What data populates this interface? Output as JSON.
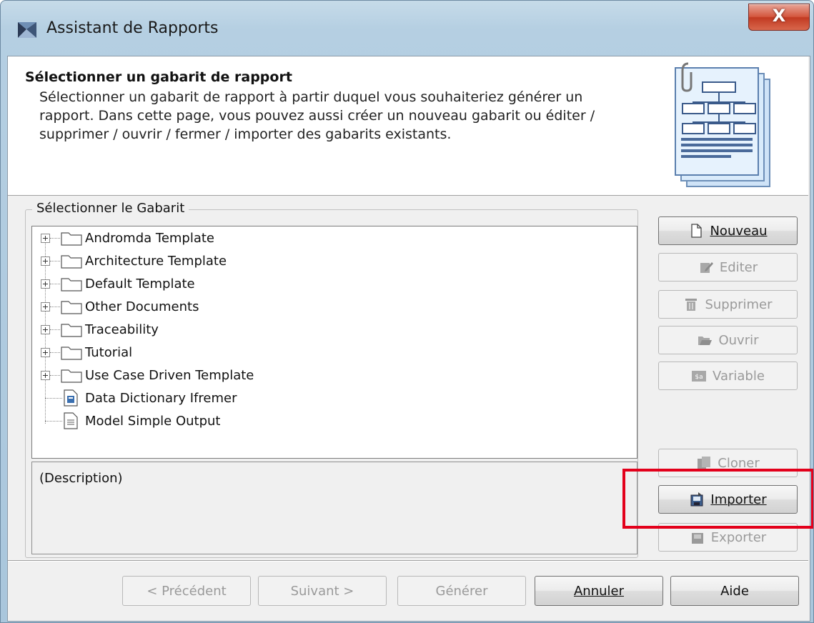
{
  "window": {
    "title": "Assistant de Rapports",
    "close_label": "X"
  },
  "header": {
    "title": "Sélectionner un gabarit de rapport",
    "description": "Sélectionner un gabarit de rapport à partir duquel vous souhaiteriez générer un rapport. Dans cette page, vous pouvez aussi créer un nouveau gabarit ou éditer / supprimer / ouvrir / fermer / importer des gabarits existants."
  },
  "template_group": {
    "label": "Sélectionner le Gabarit",
    "tree": [
      {
        "label": "Andromda Template",
        "type": "folder"
      },
      {
        "label": "Architecture Template",
        "type": "folder"
      },
      {
        "label": "Default Template",
        "type": "folder"
      },
      {
        "label": "Other Documents",
        "type": "folder"
      },
      {
        "label": "Traceability",
        "type": "folder"
      },
      {
        "label": "Tutorial",
        "type": "folder"
      },
      {
        "label": "Use Case Driven Template",
        "type": "folder"
      },
      {
        "label": "Data Dictionary Ifremer",
        "type": "file"
      },
      {
        "label": "Model Simple Output",
        "type": "file"
      }
    ],
    "description_label": "(Description)"
  },
  "side_buttons": {
    "nouveau": "Nouveau",
    "editer": "Editer",
    "supprimer": "Supprimer",
    "ouvrir": "Ouvrir",
    "variable": "Variable",
    "cloner": "Cloner",
    "importer": "Importer",
    "exporter": "Exporter"
  },
  "bottom_buttons": {
    "precedent": "< Précédent",
    "suivant": "Suivant >",
    "generer": "Générer",
    "annuler": "Annuler",
    "aide": "Aide"
  },
  "colors": {
    "highlight_box": "#e3001b",
    "window_frame": "#b5cfe2",
    "close_button": "#c23a22"
  }
}
